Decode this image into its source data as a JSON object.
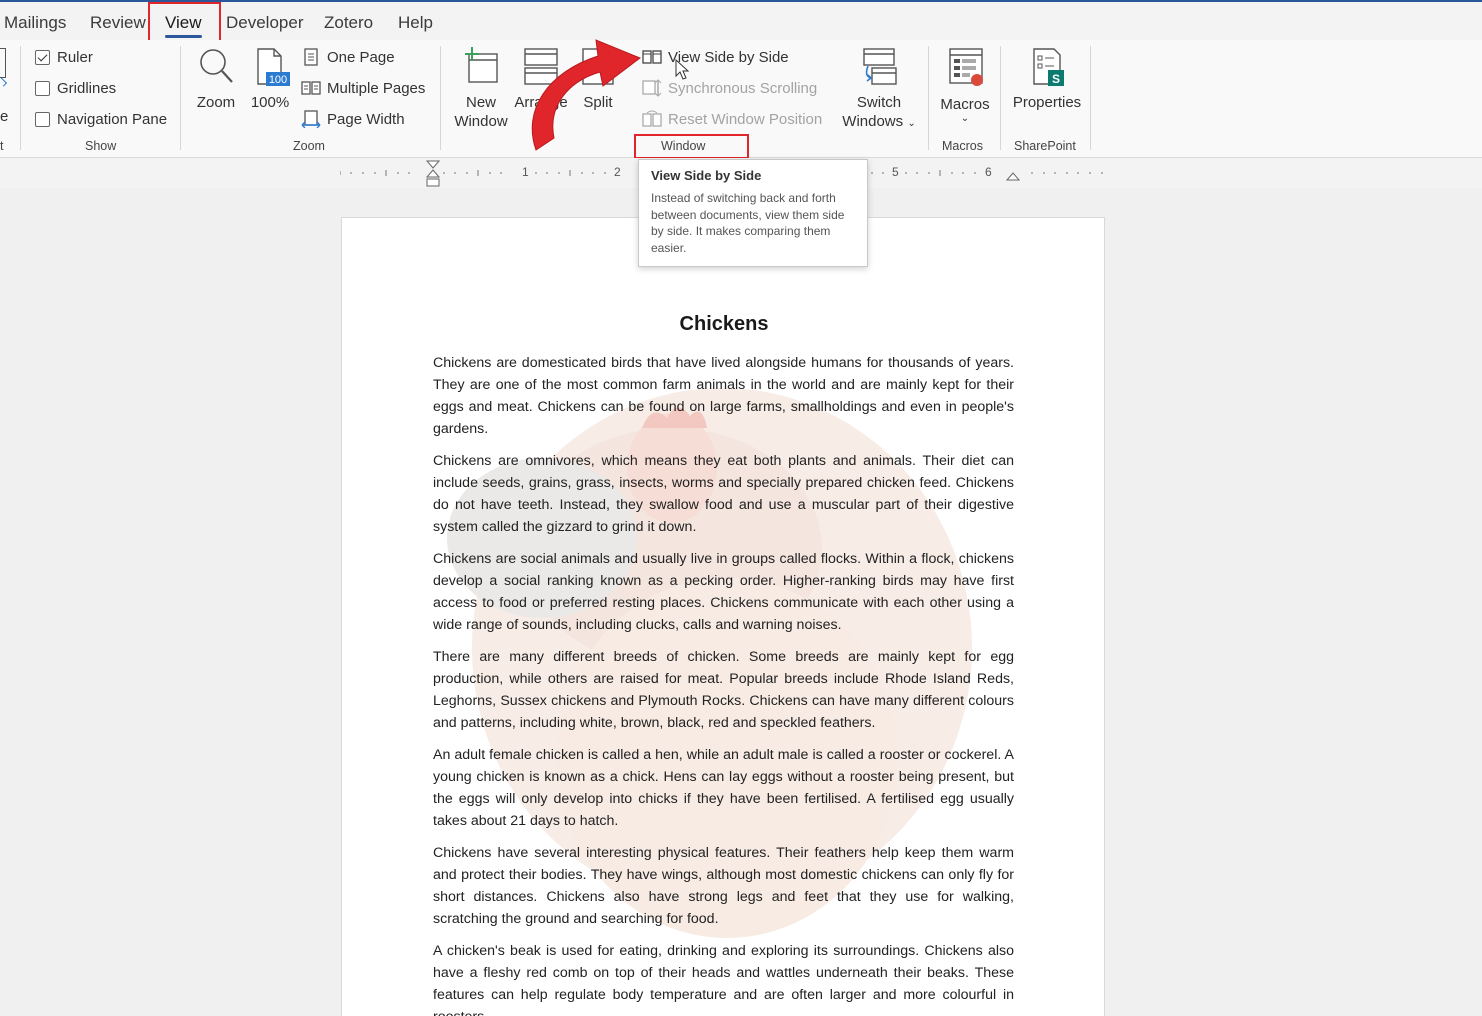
{
  "tabs": [
    {
      "id": "mailings",
      "label": "Mailings",
      "active": false
    },
    {
      "id": "review",
      "label": "Review",
      "active": false
    },
    {
      "id": "view",
      "label": "View",
      "active": true
    },
    {
      "id": "developer",
      "label": "Developer",
      "active": false
    },
    {
      "id": "zotero",
      "label": "Zotero",
      "active": false
    },
    {
      "id": "help",
      "label": "Help",
      "active": false
    }
  ],
  "ribbon": {
    "left_edge": {
      "label_fragment": "e",
      "label_fragment2": "t"
    },
    "show": {
      "label": "Show",
      "ruler": {
        "label": "Ruler",
        "checked": true
      },
      "gridlines": {
        "label": "Gridlines",
        "checked": false
      },
      "navigation_pane": {
        "label": "Navigation Pane",
        "checked": false
      }
    },
    "zoom": {
      "label": "Zoom",
      "zoom_button": "Zoom",
      "hundred_button": "100%",
      "hundred_icon_text": "100",
      "one_page": "One Page",
      "multiple_pages": "Multiple Pages",
      "page_width": "Page Width"
    },
    "window": {
      "label": "Window",
      "new_window": [
        "New",
        "Window"
      ],
      "arrange_all": [
        "Arrange",
        "All"
      ],
      "split": "Split",
      "view_side_by_side": "View Side by Side",
      "synchronous_scrolling": "Synchronous Scrolling",
      "reset_window_position": "Reset Window Position",
      "switch_windows": [
        "Switch",
        "Windows"
      ]
    },
    "macros": {
      "label": "Macros",
      "button": "Macros"
    },
    "sharepoint": {
      "label": "SharePoint",
      "button": "Properties",
      "icon_text": "S"
    }
  },
  "ruler": {
    "numbers": [
      "1",
      "2",
      "5",
      "6"
    ]
  },
  "tooltip": {
    "title": "View Side by Side",
    "description": "Instead of switching back and forth between documents, view them side by side. It makes comparing them easier."
  },
  "document": {
    "title": "Chickens",
    "paragraphs": [
      "Chickens are domesticated birds that have lived alongside humans for thousands of years. They are one of the most common farm animals in the world and are mainly kept for their eggs and meat. Chickens can be found on large farms, smallholdings and even in people's gardens.",
      "Chickens are omnivores, which means they eat both plants and animals. Their diet can include seeds, grains, grass, insects, worms and specially prepared chicken feed. Chickens do not have teeth. Instead, they swallow food and use a muscular part of their digestive system called the gizzard to grind it down.",
      "Chickens are social animals and usually live in groups called flocks. Within a flock, chickens develop a social ranking known as a pecking order. Higher-ranking birds may have first access to food or preferred resting places. Chickens communicate with each other using a wide range of sounds, including clucks, calls and warning noises.",
      "There are many different breeds of chicken. Some breeds are mainly kept for egg production, while others are raised for meat. Popular breeds include Rhode Island Reds, Leghorns, Sussex chickens and Plymouth Rocks. Chickens can have many different colours and patterns, including white, brown, black, red and speckled feathers.",
      "An adult female chicken is called a hen, while an adult male is called a rooster or cockerel. A young chicken is known as a chick. Hens can lay eggs without a rooster being present, but the eggs will only develop into chicks if they have been fertilised. A fertilised egg usually takes about 21 days to hatch.",
      "Chickens have several interesting physical features. Their feathers help keep them warm and protect their bodies. They have wings, although most domestic chickens can only fly for short distances. Chickens also have strong legs and feet that they use for walking, scratching the ground and searching for food.",
      "A chicken's beak is used for eating, drinking and exploring its surroundings. Chickens also have a fleshy red comb on top of their heads and wattles underneath their beaks. These features can help regulate body temperature and are often larger and more colourful in roosters."
    ]
  },
  "colors": {
    "accent": "#2b579a",
    "highlight": "#e0252b"
  }
}
